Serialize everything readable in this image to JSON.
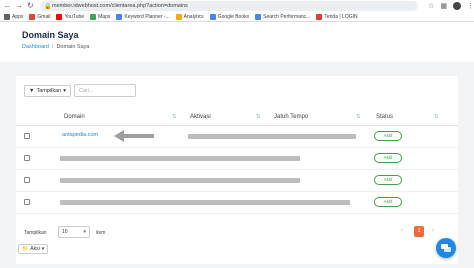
{
  "browser": {
    "url": "member.idwebhost.com/clientarea.php?action=domains",
    "bookmarks": [
      {
        "icon": "apps-icon",
        "label": "Apps",
        "color": "#5f6368"
      },
      {
        "icon": "gmail-icon",
        "label": "Gmail",
        "color": "#ea4335"
      },
      {
        "icon": "youtube-icon",
        "label": "YouTube",
        "color": "#ff0000"
      },
      {
        "icon": "maps-icon",
        "label": "Maps",
        "color": "#34a853"
      },
      {
        "icon": "keyword-planner-icon",
        "label": "Keyword Planner -...",
        "color": "#4285f4"
      },
      {
        "icon": "analytics-icon",
        "label": "Analytics",
        "color": "#f9ab00"
      },
      {
        "icon": "google-books-icon",
        "label": "Google Books",
        "color": "#4285f4"
      },
      {
        "icon": "search-performance-icon",
        "label": "Search Performanc...",
        "color": "#4285f4"
      },
      {
        "icon": "tenda-icon",
        "label": "Tenda | LOGIN",
        "color": "#e53935"
      }
    ]
  },
  "header": {
    "title": "Domain Saya",
    "breadcrumb": {
      "link": "Dashboard",
      "separator": "/",
      "current": "Domain Saya"
    }
  },
  "toolbar": {
    "filter_label": "Tampilkan",
    "search_placeholder": "Cari..."
  },
  "table": {
    "columns": [
      "Domain",
      "Aktivasi",
      "Jatuh Tempo",
      "Status"
    ],
    "rows": [
      {
        "domain": "antapedia.com",
        "status": "Aktif"
      },
      {
        "domain": "",
        "status": "Aktif"
      },
      {
        "domain": "",
        "status": "Aktif"
      },
      {
        "domain": "",
        "status": "Aktif"
      }
    ]
  },
  "footer": {
    "show_label": "Tampilkan",
    "per_page": "10",
    "item_label": "item",
    "prev": "‹",
    "current_page": "1",
    "next": "›",
    "action_label": "Aksi"
  },
  "colors": {
    "accent": "#1e88e5",
    "active": "#43a047",
    "pager": "#ef6c3a"
  }
}
